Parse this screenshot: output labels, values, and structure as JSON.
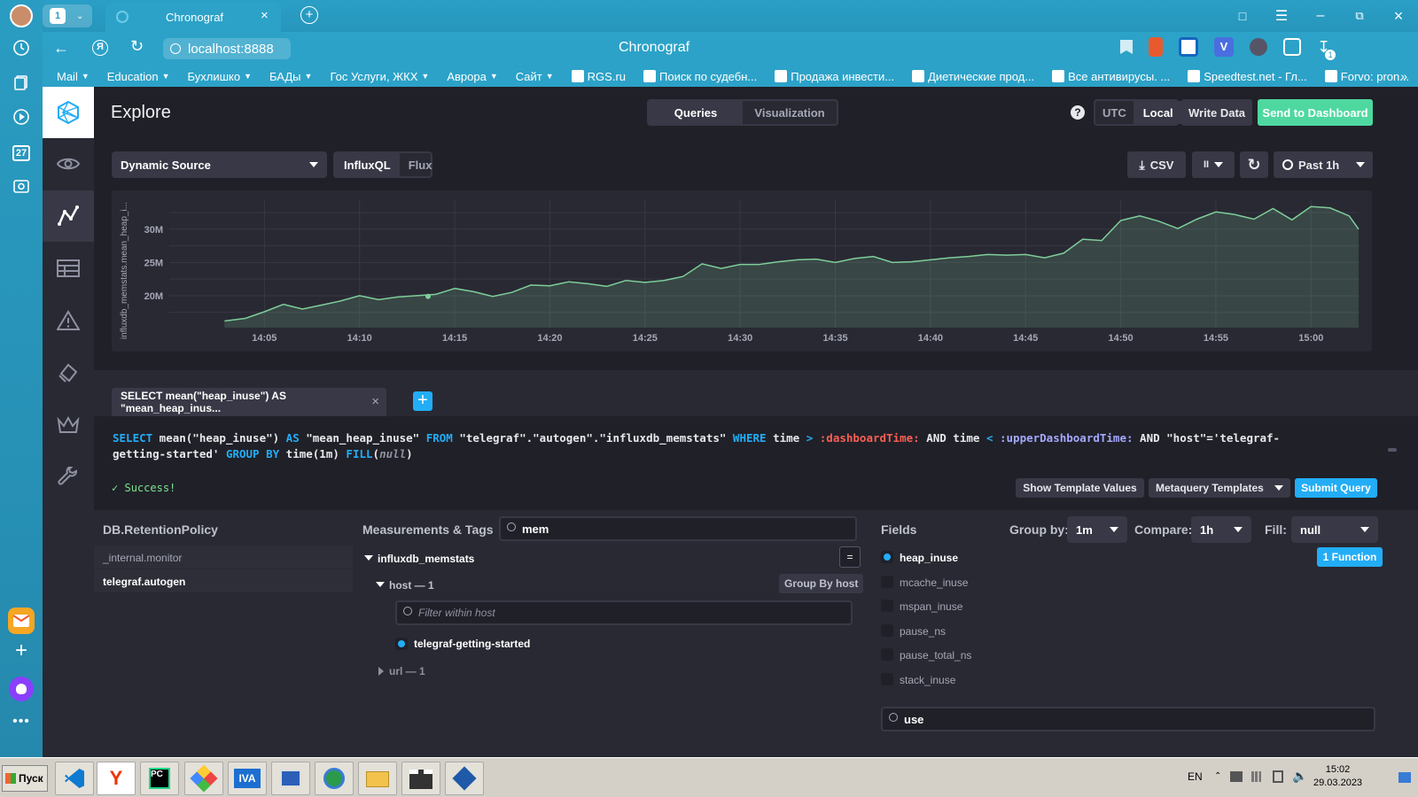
{
  "browser": {
    "tab_count": "1",
    "tab_title": "Chronograf",
    "url": "localhost:8888",
    "page_title": "Chronograf",
    "download_badge": "1",
    "bookmarks": [
      {
        "label": "Mail",
        "menu": true
      },
      {
        "label": "Education",
        "menu": true
      },
      {
        "label": "Бухлишко",
        "menu": true
      },
      {
        "label": "БАДы",
        "menu": true
      },
      {
        "label": "Гос Услуги, ЖКХ",
        "menu": true
      },
      {
        "label": "Аврора",
        "menu": true
      },
      {
        "label": "Сайт",
        "menu": true
      },
      {
        "label": "RGS.ru",
        "menu": false
      },
      {
        "label": "Поиск по судебн...",
        "menu": false
      },
      {
        "label": "Продажа инвести...",
        "menu": false
      },
      {
        "label": "Диетические прод...",
        "menu": false
      },
      {
        "label": "Все антивирусы. ...",
        "menu": false
      },
      {
        "label": "Speedtest.net - Гл...",
        "menu": false
      },
      {
        "label": "Forvo: pron...",
        "menu": false
      }
    ],
    "sidebar_calendar_day": "27"
  },
  "header": {
    "title": "Explore",
    "tabs": [
      "Queries",
      "Visualization"
    ],
    "active_tab": "Queries",
    "help_label": "?",
    "tz_options": [
      "UTC",
      "Local"
    ],
    "tz_active": "Local",
    "write_data_label": "Write Data",
    "send_to_dashboard_label": "Send to Dashboard"
  },
  "toolbar": {
    "source_label": "Dynamic Source",
    "lang_options": [
      "InfluxQL",
      "Flux"
    ],
    "lang_active": "InfluxQL",
    "csv_label": "CSV",
    "pause_label": "II",
    "time_range_label": "Past 1h"
  },
  "chart_data": {
    "type": "area",
    "ylabel": "influxdb_memstats.mean_heap_i...",
    "y_ticks": [
      "20M",
      "25M",
      "30M"
    ],
    "x_ticks": [
      "14:05",
      "14:10",
      "14:15",
      "14:20",
      "14:25",
      "14:30",
      "14:35",
      "14:40",
      "14:45",
      "14:50",
      "14:55",
      "15:00"
    ],
    "ylim": [
      15.2,
      34.5
    ],
    "x_start_min": 2.9,
    "x_end_min": 62.5,
    "series": [
      {
        "color": "#7ece9a",
        "x": [
          2.9,
          4,
          5,
          6,
          7,
          8,
          9,
          10,
          11,
          12,
          13,
          14,
          15,
          16,
          17,
          18,
          19,
          20,
          21,
          22,
          23,
          24,
          25,
          26,
          27,
          28,
          29,
          30,
          31,
          32,
          33,
          34,
          35,
          36,
          37,
          38,
          39,
          40,
          41,
          42,
          43,
          44,
          45,
          46,
          47,
          48,
          49,
          50,
          51,
          52,
          53,
          54,
          55,
          56,
          57,
          58,
          59,
          60,
          61,
          62,
          62.5
        ],
        "y": [
          16.2,
          16.6,
          17.6,
          18.7,
          18.0,
          18.6,
          19.2,
          20.0,
          19.4,
          19.8,
          20.0,
          20.2,
          21.1,
          20.6,
          19.9,
          20.5,
          21.6,
          21.5,
          22.1,
          21.8,
          21.4,
          22.3,
          22.0,
          22.3,
          22.9,
          24.8,
          24.1,
          24.7,
          24.7,
          25.1,
          25.4,
          25.5,
          25.0,
          25.6,
          25.9,
          25.0,
          25.1,
          25.4,
          25.7,
          25.9,
          26.2,
          26.1,
          26.2,
          25.7,
          26.4,
          28.5,
          28.3,
          31.3,
          32.0,
          31.2,
          30.1,
          31.5,
          32.6,
          32.2,
          31.5,
          33.1,
          31.4,
          33.4,
          33.2,
          32.0,
          30.0
        ]
      }
    ],
    "highlight_point": {
      "x": 13.6,
      "y": 19.9
    }
  },
  "query": {
    "tab_label": "SELECT mean(\"heap_inuse\") AS \"mean_heap_inus...",
    "tab_close": "×",
    "add_label": "+",
    "line1_parts": [
      {
        "t": "SELECT",
        "c": "kw"
      },
      {
        "t": " mean(\"heap_inuse\") ",
        "c": "str"
      },
      {
        "t": "AS",
        "c": "kw"
      },
      {
        "t": " \"mean_heap_inuse\" ",
        "c": "str"
      },
      {
        "t": "FROM",
        "c": "kw"
      },
      {
        "t": " \"telegraf\".\"autogen\".\"influxdb_memstats\" ",
        "c": "str"
      },
      {
        "t": "WHERE",
        "c": "kw"
      },
      {
        "t": " time ",
        "c": "str"
      },
      {
        "t": ">",
        "c": "kw"
      },
      {
        "t": " :dashboardTime:",
        "c": "tv"
      },
      {
        "t": " AND time ",
        "c": "str"
      },
      {
        "t": "<",
        "c": "kw"
      },
      {
        "t": " :upperDashboardTime:",
        "c": "tv2"
      },
      {
        "t": " AND \"host\"='telegraf-",
        "c": "str"
      }
    ],
    "line2_parts": [
      {
        "t": "getting-started' ",
        "c": "str"
      },
      {
        "t": "GROUP BY",
        "c": "kw"
      },
      {
        "t": " time(1m) ",
        "c": "str"
      },
      {
        "t": "FILL",
        "c": "kw"
      },
      {
        "t": "(null)",
        "c": "str"
      }
    ],
    "status": "Success!",
    "show_template_values_label": "Show Template Values",
    "metaquery_templates_label": "Metaquery Templates",
    "submit_label": "Submit Query"
  },
  "db_panel": {
    "title": "DB.RetentionPolicy",
    "items": [
      "_internal.monitor",
      "telegraf.autogen"
    ],
    "selected": "telegraf.autogen"
  },
  "measurements_panel": {
    "title": "Measurements & Tags",
    "search_value": "mem",
    "measurement": "influxdb_memstats",
    "toggle_label": "=",
    "tag_host": "host — 1",
    "group_by_host_label": "Group By host",
    "filter_placeholder": "Filter within host",
    "host_value": "telegraf-getting-started",
    "tag_url": "url — 1"
  },
  "fields_panel": {
    "title": "Fields",
    "group_by_label": "Group by:",
    "group_by_value": "1m",
    "compare_label": "Compare:",
    "compare_value": "1h",
    "fill_label": "Fill:",
    "fill_value": "null",
    "function_label": "1 Function",
    "fields": [
      {
        "name": "heap_inuse",
        "checked": true
      },
      {
        "name": "mcache_inuse",
        "checked": false
      },
      {
        "name": "mspan_inuse",
        "checked": false
      },
      {
        "name": "pause_ns",
        "checked": false
      },
      {
        "name": "pause_total_ns",
        "checked": false
      },
      {
        "name": "stack_inuse",
        "checked": false
      }
    ],
    "search_value": "use"
  },
  "taskbar": {
    "start_label": "Пуск",
    "lang": "EN",
    "time": "15:02",
    "date": "29.03.2023"
  },
  "colors": {
    "accent_green": "#4ed8a0",
    "accent_blue": "#22adf6",
    "bg": "#202028",
    "panel": "#292933",
    "series": "#7ece9a"
  }
}
